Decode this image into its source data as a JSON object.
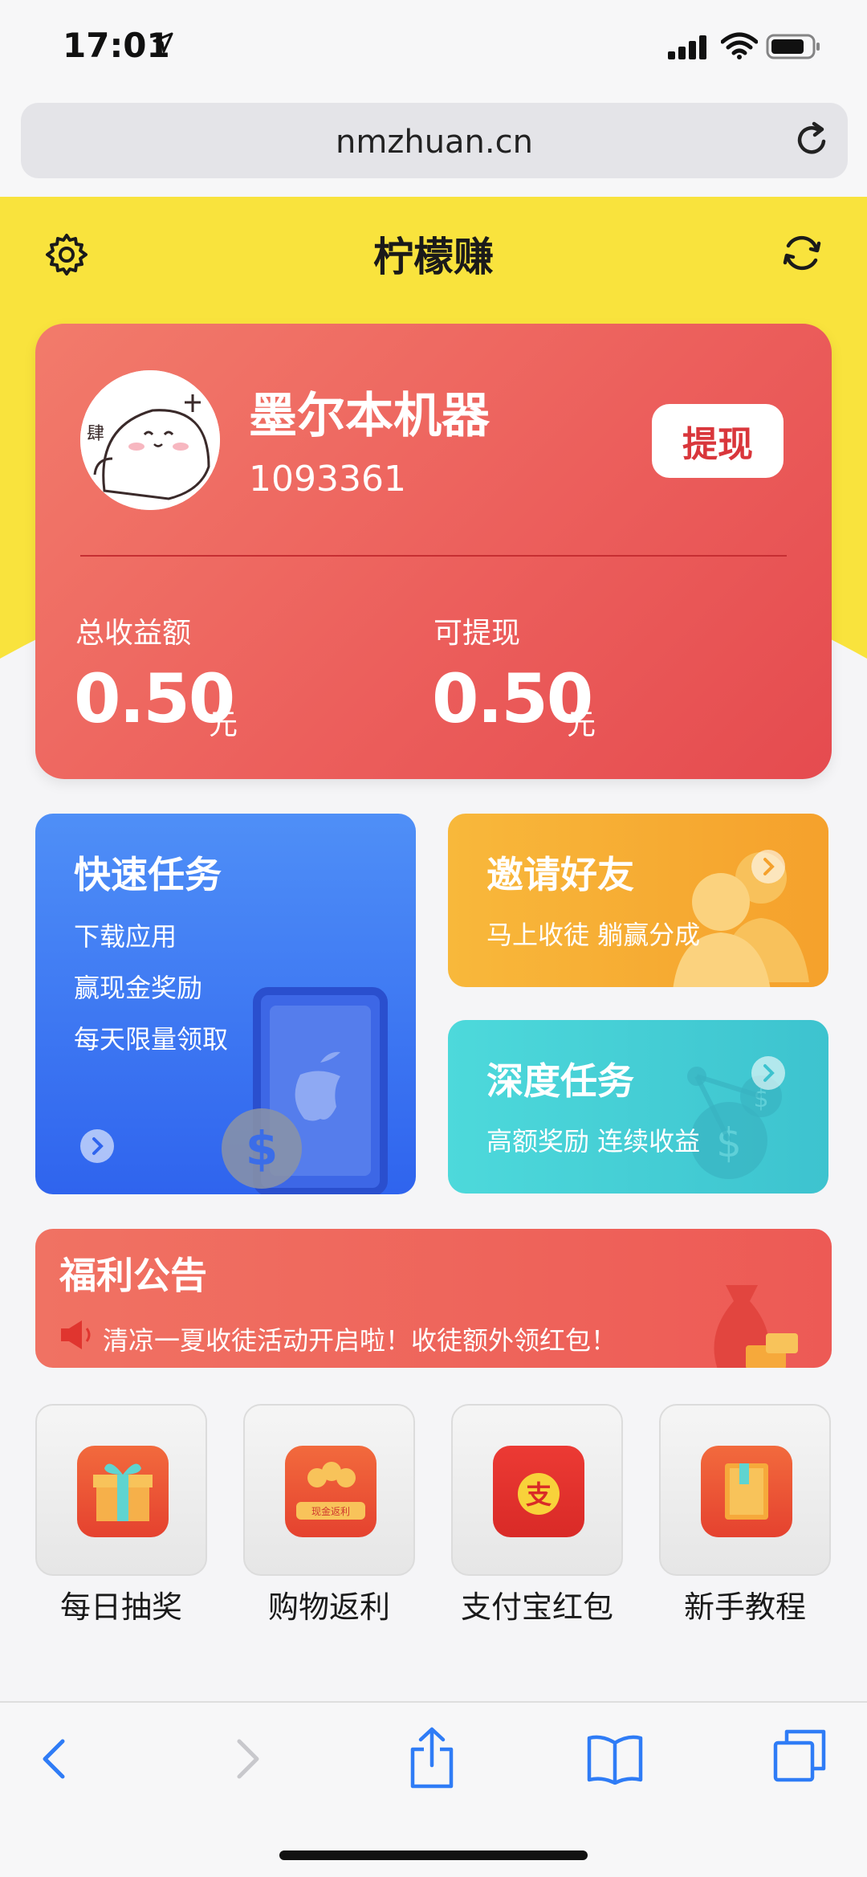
{
  "status_bar": {
    "time": "17:01"
  },
  "browser": {
    "url": "nmzhuan.cn"
  },
  "header": {
    "title": "柠檬赚"
  },
  "profile": {
    "name": "墨尔本机器",
    "id": "1093361",
    "withdraw_label": "提现",
    "total_label": "总收益额",
    "total_value": "0.50",
    "total_unit": "元",
    "available_label": "可提现",
    "available_value": "0.50",
    "available_unit": "元"
  },
  "tasks": {
    "quick": {
      "title": "快速任务",
      "lines": [
        "下载应用",
        "赢现金奖励",
        "每天限量领取"
      ]
    },
    "invite": {
      "title": "邀请好友",
      "subtitle": "马上收徒 躺赢分成"
    },
    "deep": {
      "title": "深度任务",
      "subtitle": "高额奖励 连续收益"
    }
  },
  "notice": {
    "title": "福利公告",
    "text": "清凉一夏收徒活动开启啦！收徒额外领红包！"
  },
  "quick_icons": [
    {
      "label": "每日抽奖",
      "icon": "gift-icon"
    },
    {
      "label": "购物返利",
      "icon": "red-envelope-icon",
      "badge": "现金返利"
    },
    {
      "label": "支付宝红包",
      "icon": "alipay-icon",
      "glyph": "支"
    },
    {
      "label": "新手教程",
      "icon": "book-icon"
    }
  ],
  "colors": {
    "header_yellow": "#f9e33d",
    "card_red": "#ec5f5c",
    "quick_blue": "#2f64ee",
    "invite_orange": "#f5a12c",
    "deep_cyan": "#3dc3cf",
    "ios_blue": "#2f7cf6"
  }
}
